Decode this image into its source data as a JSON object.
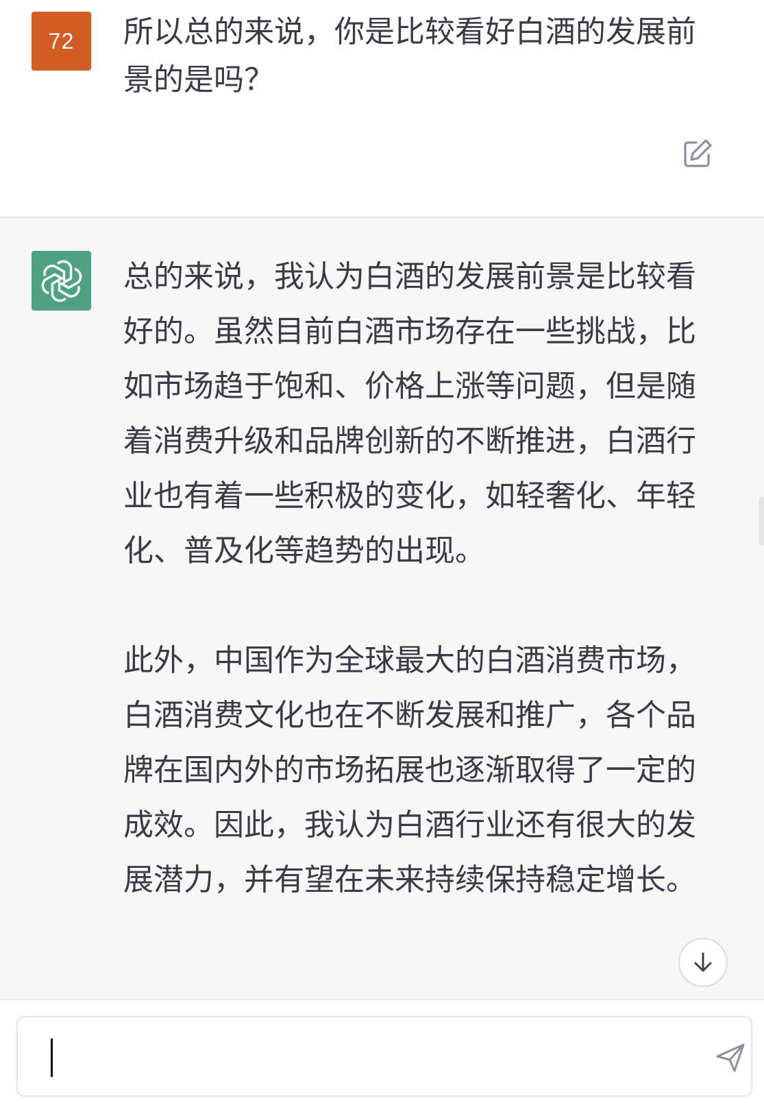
{
  "user_message": {
    "avatar_label": "72",
    "avatar_color": "#d35b24",
    "text": "所以总的来说，你是比较看好白酒的发展前景的是吗？",
    "edit_icon": "edit-icon"
  },
  "assistant_message": {
    "avatar_icon": "openai-logo-icon",
    "avatar_color": "#4ea283",
    "paragraphs": [
      "总的来说，我认为白酒的发展前景是比较看好的。虽然目前白酒市场存在一些挑战，比如市场趋于饱和、价格上涨等问题，但是随着消费升级和品牌创新的不断推进，白酒行业也有着一些积极的变化，如轻奢化、年轻化、普及化等趋势的出现。",
      "此外，中国作为全球最大的白酒消费市场，白酒消费文化也在不断发展和推广，各个品牌在国内外的市场拓展也逐渐取得了一定的成效。因此，我认为白酒行业还有很大的发展潜力，并有望在未来持续保持稳定增长。"
    ]
  },
  "controls": {
    "scroll_down_icon": "arrow-down-icon",
    "send_icon": "send-icon"
  },
  "composer": {
    "value": "",
    "placeholder": ""
  }
}
